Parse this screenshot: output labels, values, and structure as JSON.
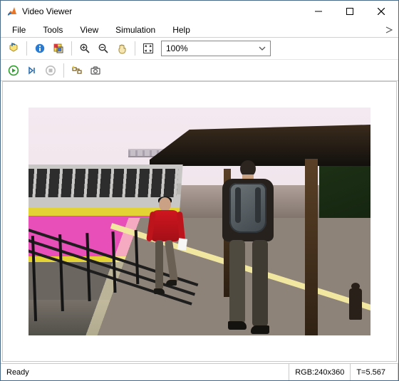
{
  "window": {
    "title": "Video Viewer"
  },
  "menu": {
    "items": [
      "File",
      "Tools",
      "View",
      "Simulation",
      "Help"
    ]
  },
  "toolbar": {
    "zoom_value": "100%"
  },
  "status": {
    "ready": "Ready",
    "format": "RGB:240x360",
    "time": "T=5.567"
  },
  "icons": {
    "app": "matlab-icon",
    "min": "minimize",
    "max": "maximize",
    "close": "close"
  }
}
